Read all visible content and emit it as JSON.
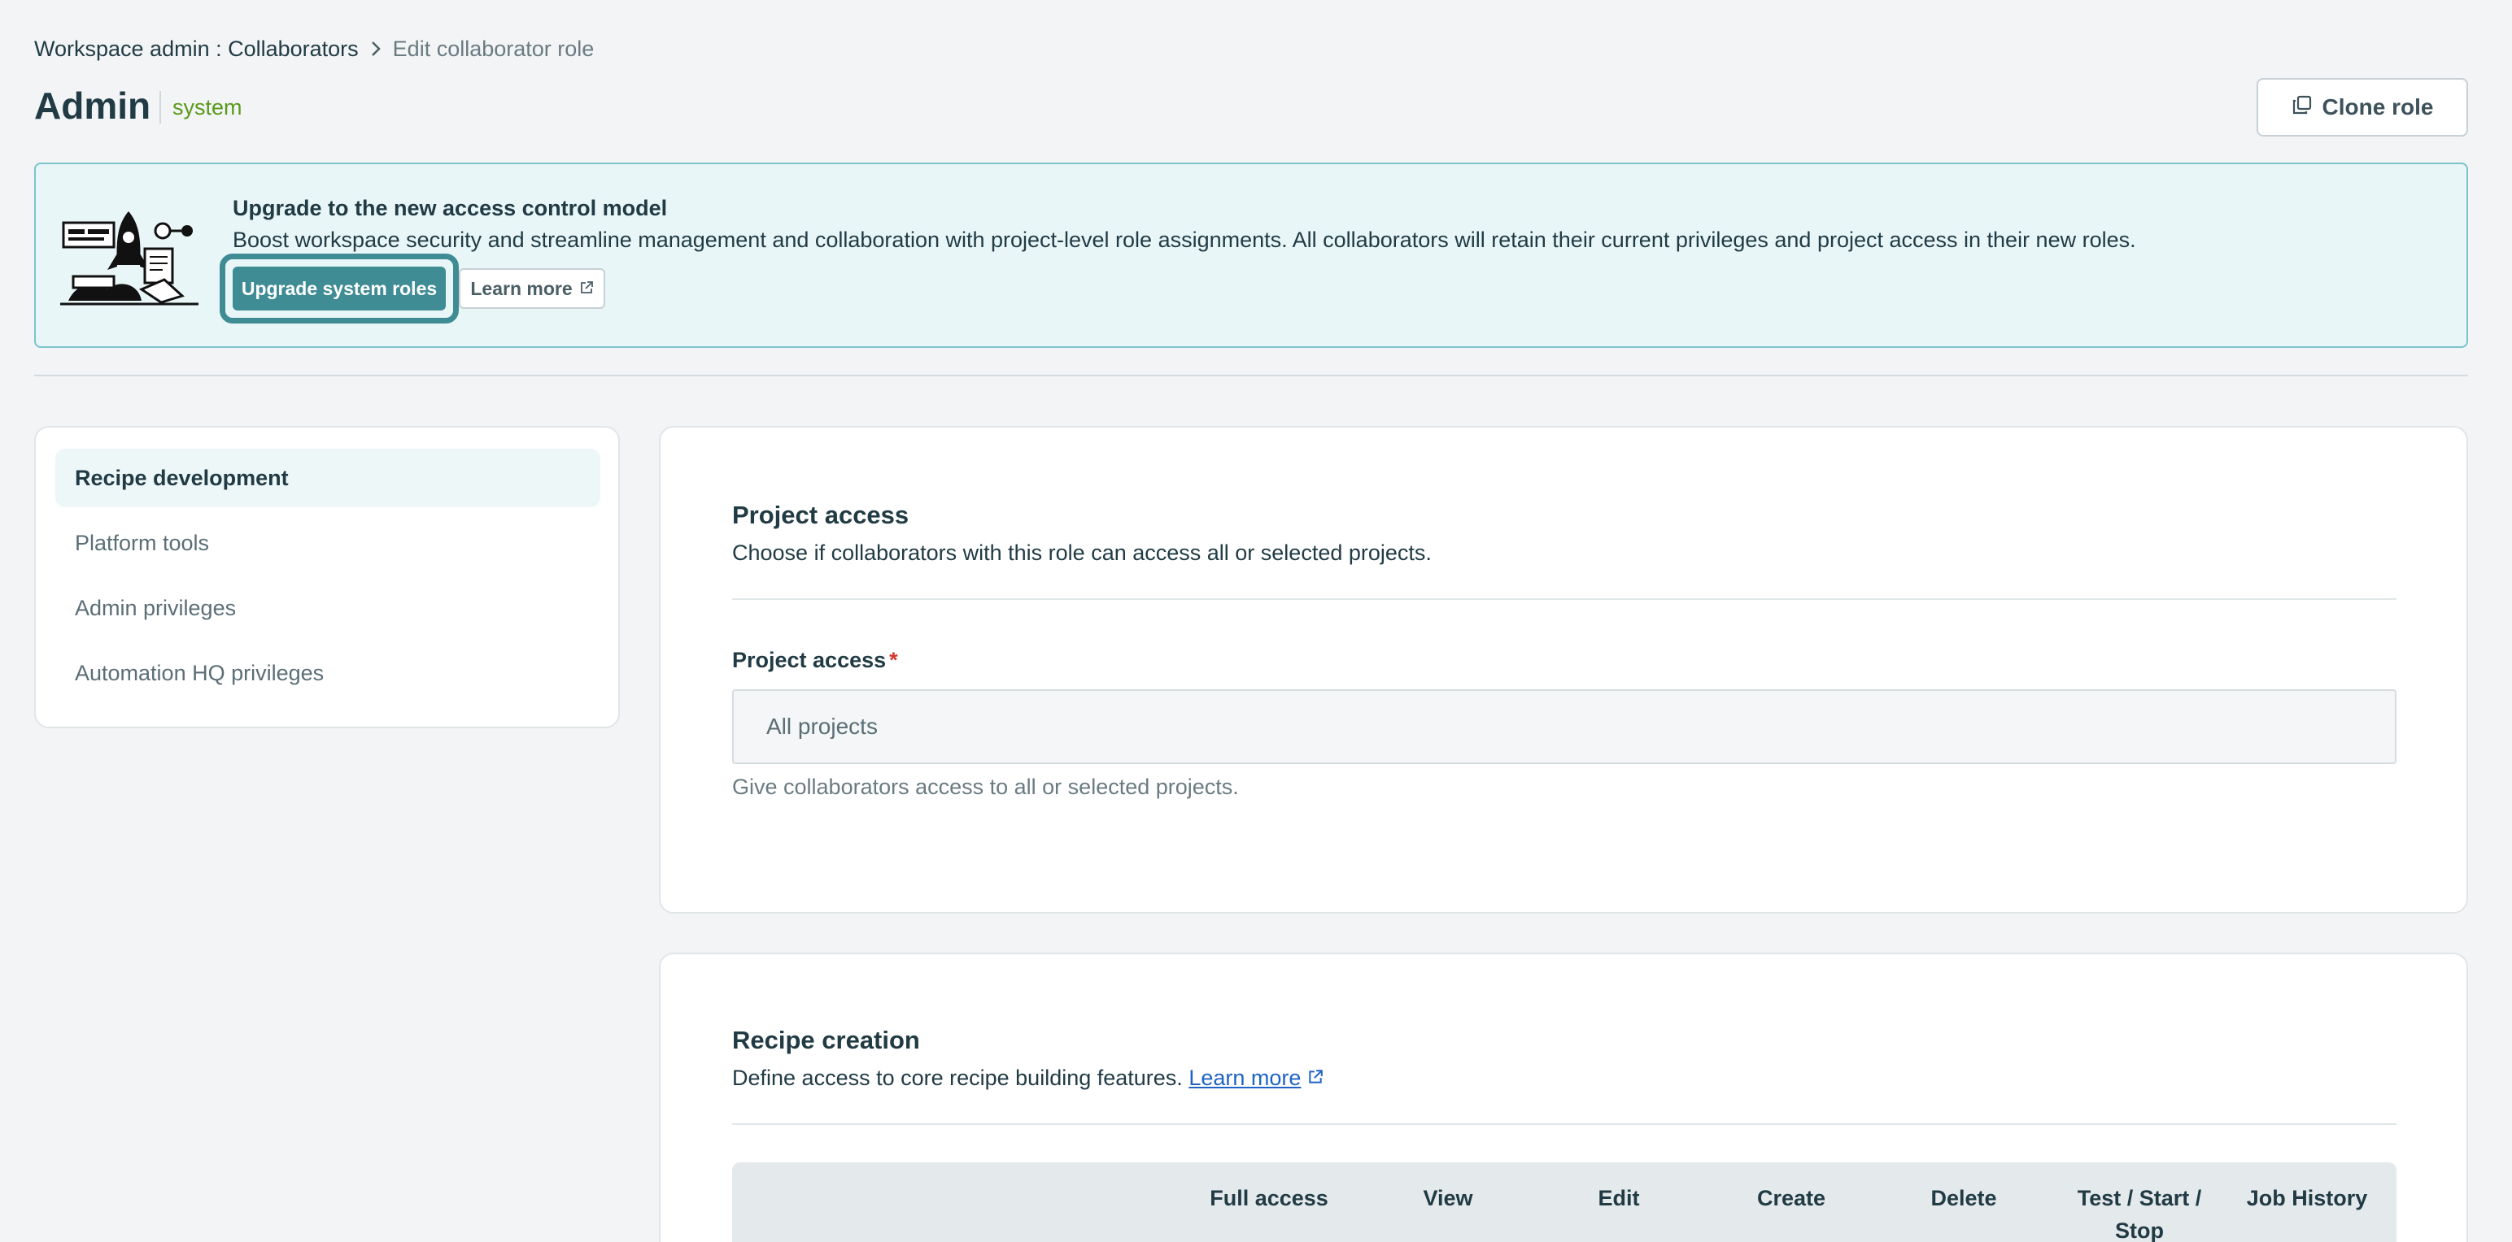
{
  "breadcrumb": {
    "parent": "Workspace admin : Collaborators",
    "current": "Edit collaborator role"
  },
  "header": {
    "title": "Admin",
    "badge": "system",
    "clone_button": "Clone role"
  },
  "banner": {
    "title": "Upgrade to the new access control model",
    "body": "Boost workspace security and streamline management and collaboration with project-level role assignments. All collaborators will retain their current privileges and project access in their new roles.",
    "primary_button": "Upgrade system roles",
    "secondary_button": "Learn more"
  },
  "sidebar": {
    "items": [
      {
        "label": "Recipe development",
        "active": true
      },
      {
        "label": "Platform tools",
        "active": false
      },
      {
        "label": "Admin privileges",
        "active": false
      },
      {
        "label": "Automation HQ privileges",
        "active": false
      }
    ]
  },
  "project_access": {
    "title": "Project access",
    "description": "Choose if collaborators with this role can access all or selected projects.",
    "field_label": "Project access",
    "required_mark": "*",
    "selected_value": "All projects",
    "hint": "Give collaborators access to all or selected projects."
  },
  "recipe_creation": {
    "title": "Recipe creation",
    "description": "Define access to core recipe building features.",
    "learn_more": "Learn more",
    "columns": [
      "Full access",
      "View",
      "Edit",
      "Create",
      "Delete",
      "Test / Start / Stop",
      "Job History"
    ]
  },
  "colors": {
    "accent": "#3f8c95",
    "badge_green": "#5a9a1a",
    "link_blue": "#1f63c4",
    "required_red": "#d9342b"
  },
  "icons": {
    "breadcrumb_separator": "chevron-right-icon",
    "clone": "copy-icon",
    "external_link": "external-link-icon"
  }
}
